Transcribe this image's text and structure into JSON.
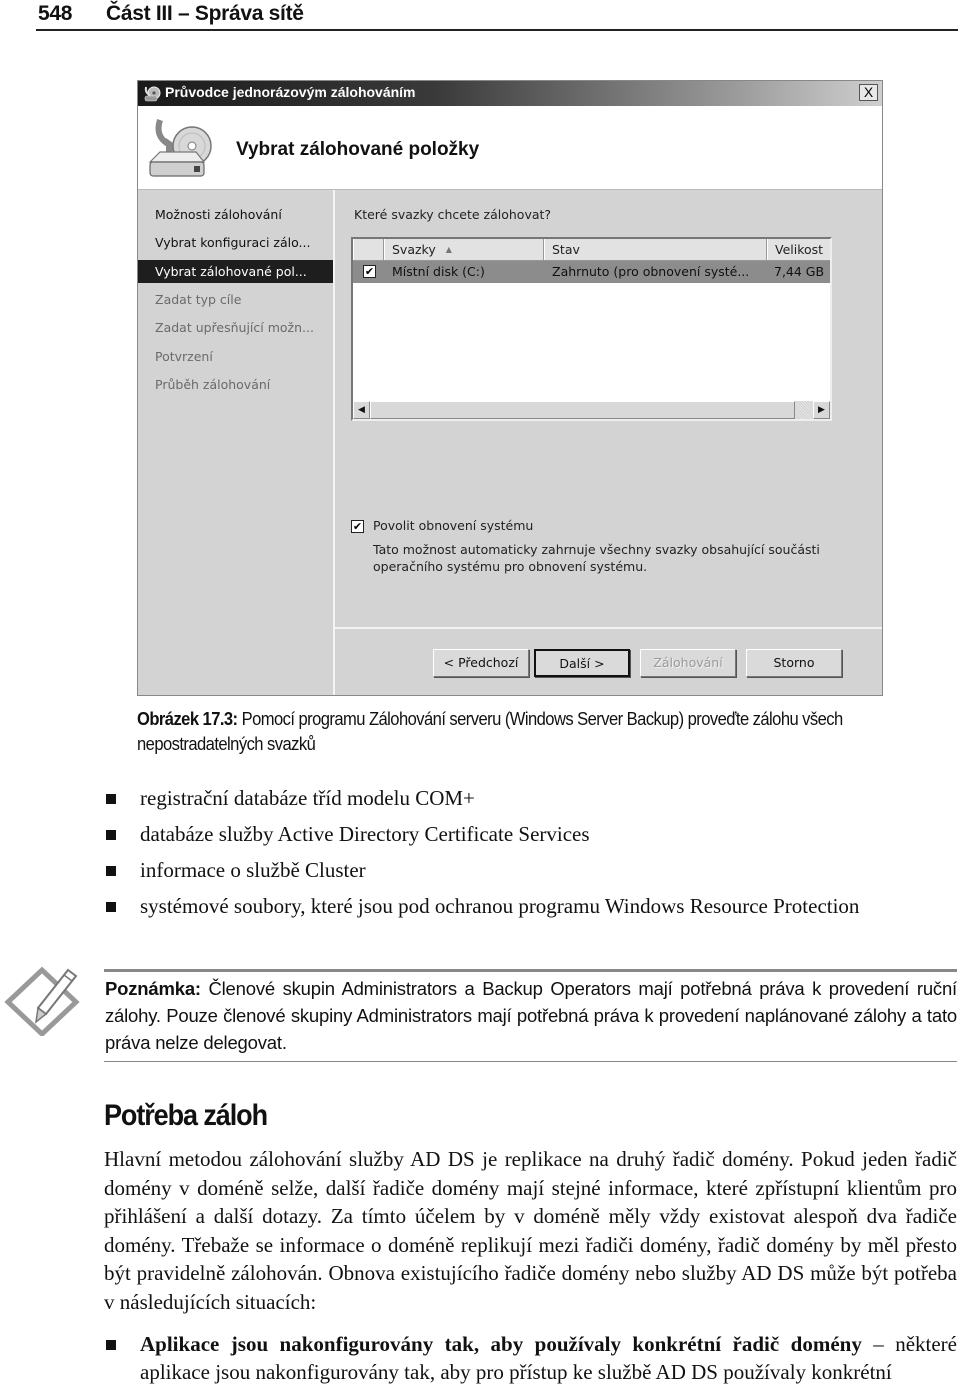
{
  "page": {
    "number": "548",
    "running_title": "Část III – Správa sítě"
  },
  "dialog": {
    "title": "Průvodce jednorázovým zálohováním",
    "close_label": "X",
    "header_title": "Vybrat zálohované položky",
    "nav": [
      {
        "label": "Možnosti zálohování",
        "state": "done"
      },
      {
        "label": "Vybrat konfiguraci zálo...",
        "state": "done"
      },
      {
        "label": "Vybrat zálohované pol...",
        "state": "active"
      },
      {
        "label": "Zadat typ cíle",
        "state": "todo"
      },
      {
        "label": "Zadat upřesňující možn...",
        "state": "todo"
      },
      {
        "label": "Potvrzení",
        "state": "todo"
      },
      {
        "label": "Průběh zálohování",
        "state": "todo"
      }
    ],
    "question": "Které svazky chcete zálohovat?",
    "table": {
      "columns": [
        "Svazky",
        "Stav",
        "Velikost"
      ],
      "sort_indicator": "▲",
      "rows": [
        {
          "checked": true,
          "volume": "Místní disk (C:)",
          "status": "Zahrnuto (pro obnovení systé...",
          "size": "7,44 GB"
        }
      ]
    },
    "scroll_left": "◀",
    "scroll_right": "▶",
    "restore_checkbox": {
      "checked": true,
      "label": "Povolit obnovení systému"
    },
    "restore_description": "Tato možnost automaticky zahrnuje všechny svazky obsahující součásti operačního systému pro obnovení systému.",
    "buttons": {
      "previous": "< Předchozí",
      "next": "Další >",
      "backup": "Zálohování",
      "cancel": "Storno"
    },
    "check_glyph": "✔"
  },
  "caption": {
    "label": "Obrázek 17.3:",
    "text": " Pomocí programu Zálohování serveru (Windows Server Backup) proveďte zálohu všech nepostradatelných svazků"
  },
  "bullets": [
    "registrační databáze tříd modelu COM+",
    "databáze služby Active Directory Certificate Services",
    "informace o službě Cluster",
    "systémové soubory, které jsou pod ochranou programu Windows Resource Protection"
  ],
  "note": {
    "label": "Poznámka:",
    "text": " Členové skupin Administrators a Backup Operators mají potřebná práva k provedení ruční zálohy. Pouze členové skupiny Administrators mají potřebná práva k provedení naplánované zálohy a tato práva nelze delegovat."
  },
  "section": {
    "heading": "Potřeba záloh",
    "paragraph": "Hlavní metodou zálohování služby AD DS je replikace na druhý řadič domény. Pokud jeden řadič domény v doméně selže, další řadiče domény mají stejné informace, které zpřístupní klientům pro přihlášení a další dotazy. Za tímto účelem by v doméně měly vždy existovat alespoň dva řadiče domény. Třebaže se informace o doméně replikují mezi řadiči domény, řadič domény by měl přesto být pravidelně zálohován. Obnova existujícího řadiče domény nebo služby AD DS může být potřeba v následujících situacích:",
    "bullet_bold": "Aplikace jsou nakonfigurovány tak, aby používaly konkrétní řadič domény",
    "bullet_rest": " – některé aplikace jsou nakonfigurovány tak, aby pro přístup ke službě AD DS používaly konkrétní"
  }
}
